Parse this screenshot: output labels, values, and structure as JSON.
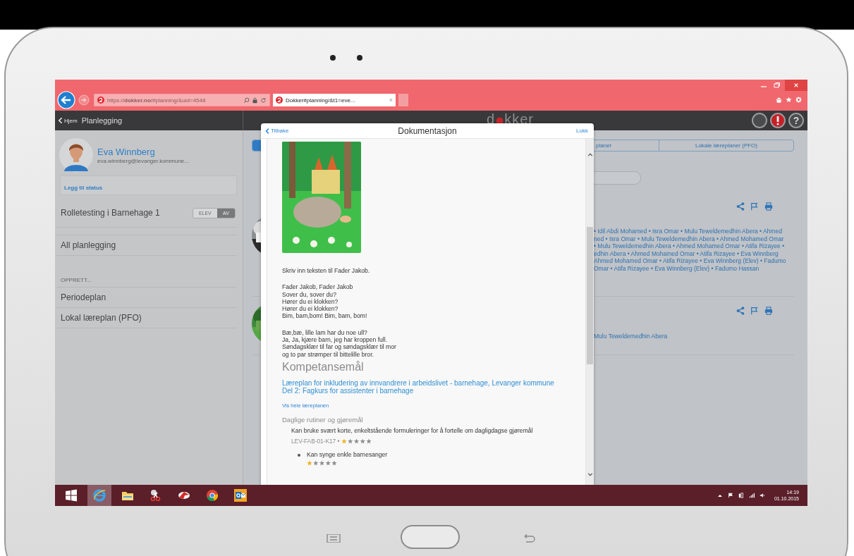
{
  "browser": {
    "address": "https://**dokker.no**/#planning/&uid=4548",
    "tab_title": "Dokker#planning/&t1=eve...",
    "tab_close": "×"
  },
  "app_header": {
    "back": "Hjem",
    "title": "Planlegging",
    "logo_left": "d",
    "logo_right": "kker",
    "help": "?"
  },
  "sidebar": {
    "profile": {
      "name": "Eva Winnberg",
      "email": "eva.winnberg@levanger.kommune...",
      "status_link": "Legg til status"
    },
    "group": {
      "title": "Rolletesting i Barnehage 1",
      "toggle": [
        {
          "label": "ELEV",
          "selected": false
        },
        {
          "label": "AV",
          "selected": true
        }
      ]
    },
    "items": [
      "All planlegging"
    ],
    "section": "OPPRETT...",
    "create_items": [
      "Periodeplan",
      "Lokal læreplan (PFO)"
    ]
  },
  "main": {
    "tabs": [
      {
        "selected": true
      },
      {
        "label": "planer",
        "selected": false
      },
      {
        "label": "Lokale læreplaner (PFO)",
        "selected": false
      }
    ],
    "cards": [
      {
        "participants": [
          "• Idil Abdi Mohamed • Isra Omar • Mulu Teweldemedhin Abera • Ahmed",
          "ned • Isra Omar • Mulu Teweldemedhin Abera • Ahmed Mohamed Omar",
          "• Mulu Teweldemedhin Abera • Ahmed Mohamed Omar • Atifa Rizayee •",
          "edhin Abera • Ahmed Mohamed Omar • Atifa Rizayee • Eva Winnberg",
          "Ahmed Mohamed Omar • Atifa Rizayee • Eva Winnberg (Elev) • Fadumo",
          "Omar • Atifa Rizayee • Eva Winnberg (Elev) • Fadumo Hassan"
        ]
      },
      {
        "participants": [
          "Mulu Teweldemedhin Abera"
        ]
      }
    ]
  },
  "modal": {
    "back": "Tilbake",
    "title": "Dokumentasjon",
    "close": "Lukk",
    "paragraphs": [
      [
        "Skriv inn teksten til Fader Jakob."
      ],
      [
        "Fader Jakob, Fader Jakob",
        "Sover du, sover du?",
        "Hører du ei klokken?",
        "Hører du ei klokken?",
        "Bim, bam,bom! Bim, bam, bom!"
      ],
      [
        "Bæ,bæ, lille lam har du noe ull?",
        "Ja, Ja, kjære barn, jeg har kroppen full.",
        "Søndagsklær til far og søndagsklær til mor",
        "og to par strømper til bittelille bror."
      ]
    ],
    "heading": "Kompetansemål",
    "curriculum_links": [
      "Læreplan for inkludering av innvandrere i arbeidslivet - barnehage, Levanger kommune",
      "Del 2: Fagkurs for assistenter i barnehage"
    ],
    "show_all": "Vis hele læreplanen",
    "topic": "Daglige rutiner og gjøremål",
    "goal": {
      "text": "Kan bruke svært korte, enkeltstående formuleringer for å fortelle om dagligdagse gjøremål",
      "code": "LEV-FAB-01-K17 •",
      "stars": 1
    },
    "sub_goals": [
      {
        "text": "Kan synge enkle barnesanger",
        "stars": 1
      }
    ]
  },
  "taskbar": {
    "apps": [
      {
        "kind": "start",
        "selected": false
      },
      {
        "kind": "ie",
        "selected": true
      },
      {
        "kind": "folder",
        "selected": false
      },
      {
        "kind": "snip",
        "selected": false
      },
      {
        "kind": "red",
        "selected": false
      },
      {
        "kind": "chrome",
        "selected": false
      },
      {
        "kind": "outlook",
        "selected": false
      }
    ],
    "time": "14:19",
    "date": "01.10.2015"
  }
}
